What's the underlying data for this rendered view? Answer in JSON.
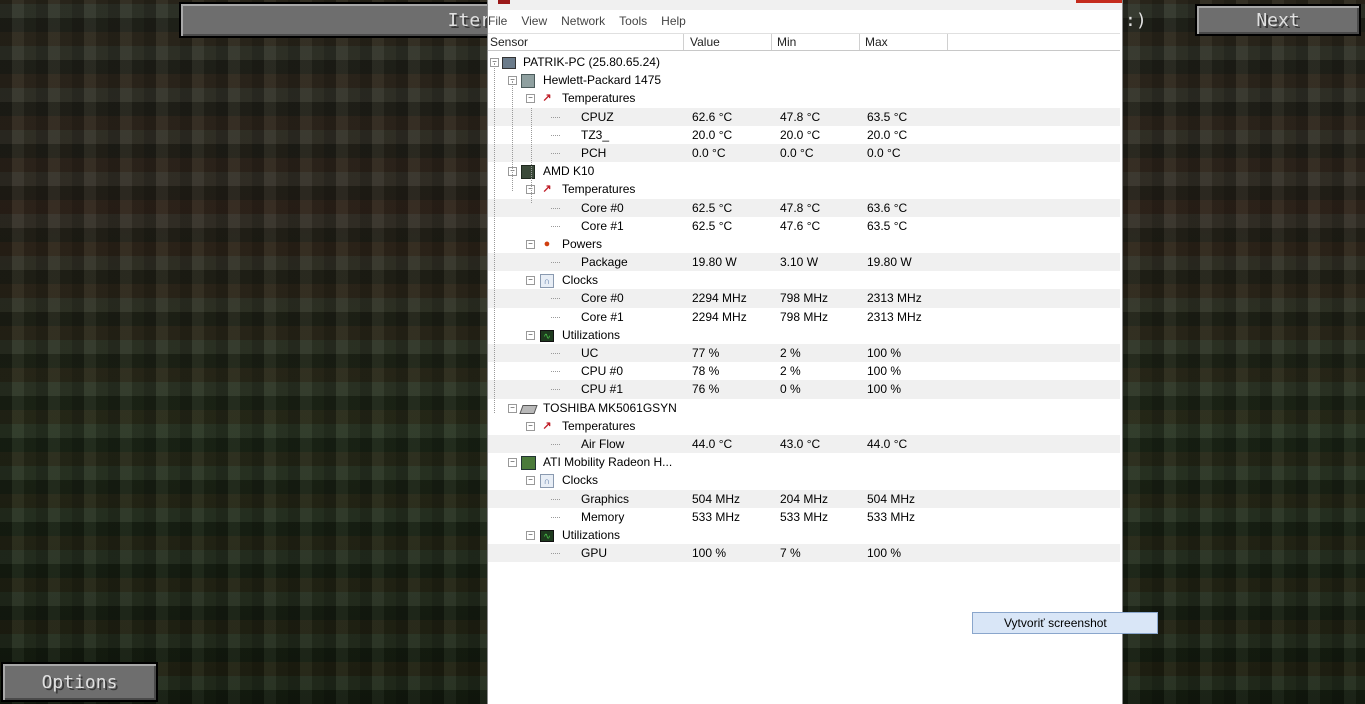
{
  "background": {
    "buttons": {
      "top_left": "Iter",
      "next": "Next",
      "options": "Options"
    },
    "top_right_fragment": ":)"
  },
  "app": {
    "menu": [
      "File",
      "View",
      "Network",
      "Tools",
      "Help"
    ],
    "columns": [
      "Sensor",
      "Value",
      "Min",
      "Max"
    ],
    "rows": [
      {
        "level": 0,
        "icon": "computer-icon",
        "label": "PATRIK-PC (25.80.65.24)"
      },
      {
        "level": 1,
        "icon": "motherboard-icon",
        "label": "Hewlett-Packard 1475"
      },
      {
        "level": 2,
        "icon": "thermometer-icon",
        "label": "Temperatures"
      },
      {
        "level": 3,
        "label": "CPUZ",
        "value": "62.6 °C",
        "min": "47.8 °C",
        "max": "63.5 °C"
      },
      {
        "level": 3,
        "label": "TZ3_",
        "value": "20.0 °C",
        "min": "20.0 °C",
        "max": "20.0 °C"
      },
      {
        "level": 3,
        "label": "PCH",
        "value": "0.0 °C",
        "min": "0.0 °C",
        "max": "0.0 °C"
      },
      {
        "level": 1,
        "icon": "cpu-icon",
        "label": "AMD K10"
      },
      {
        "level": 2,
        "icon": "thermometer-icon",
        "label": "Temperatures"
      },
      {
        "level": 3,
        "label": "Core #0",
        "value": "62.5 °C",
        "min": "47.8 °C",
        "max": "63.6 °C"
      },
      {
        "level": 3,
        "label": "Core #1",
        "value": "62.5 °C",
        "min": "47.6 °C",
        "max": "63.5 °C"
      },
      {
        "level": 2,
        "icon": "power-icon",
        "label": "Powers"
      },
      {
        "level": 3,
        "label": "Package",
        "value": "19.80 W",
        "min": "3.10 W",
        "max": "19.80 W"
      },
      {
        "level": 2,
        "icon": "clock-icon",
        "label": "Clocks"
      },
      {
        "level": 3,
        "label": "Core #0",
        "value": "2294 MHz",
        "min": "798 MHz",
        "max": "2313 MHz"
      },
      {
        "level": 3,
        "label": "Core #1",
        "value": "2294 MHz",
        "min": "798 MHz",
        "max": "2313 MHz"
      },
      {
        "level": 2,
        "icon": "utilization-icon",
        "label": "Utilizations"
      },
      {
        "level": 3,
        "label": "UC",
        "value": "77 %",
        "min": "2 %",
        "max": "100 %"
      },
      {
        "level": 3,
        "label": "CPU #0",
        "value": "78 %",
        "min": "2 %",
        "max": "100 %"
      },
      {
        "level": 3,
        "label": "CPU #1",
        "value": "76 %",
        "min": "0 %",
        "max": "100 %"
      },
      {
        "level": 1,
        "icon": "hard-drive-icon",
        "label": "TOSHIBA MK5061GSYN"
      },
      {
        "level": 2,
        "icon": "thermometer-icon",
        "label": "Temperatures"
      },
      {
        "level": 3,
        "label": "Air Flow",
        "value": "44.0 °C",
        "min": "43.0 °C",
        "max": "44.0 °C"
      },
      {
        "level": 1,
        "icon": "graphics-card-icon",
        "label": "ATI Mobility Radeon H..."
      },
      {
        "level": 2,
        "icon": "clock-icon",
        "label": "Clocks"
      },
      {
        "level": 3,
        "label": "Graphics",
        "value": "504 MHz",
        "min": "204 MHz",
        "max": "504 MHz"
      },
      {
        "level": 3,
        "label": "Memory",
        "value": "533 MHz",
        "min": "533 MHz",
        "max": "533 MHz"
      },
      {
        "level": 2,
        "icon": "utilization-icon",
        "label": "Utilizations"
      },
      {
        "level": 3,
        "label": "GPU",
        "value": "100 %",
        "min": "7 %",
        "max": "100 %"
      }
    ]
  },
  "context_menu": {
    "item": "Vytvoriť screenshot"
  }
}
